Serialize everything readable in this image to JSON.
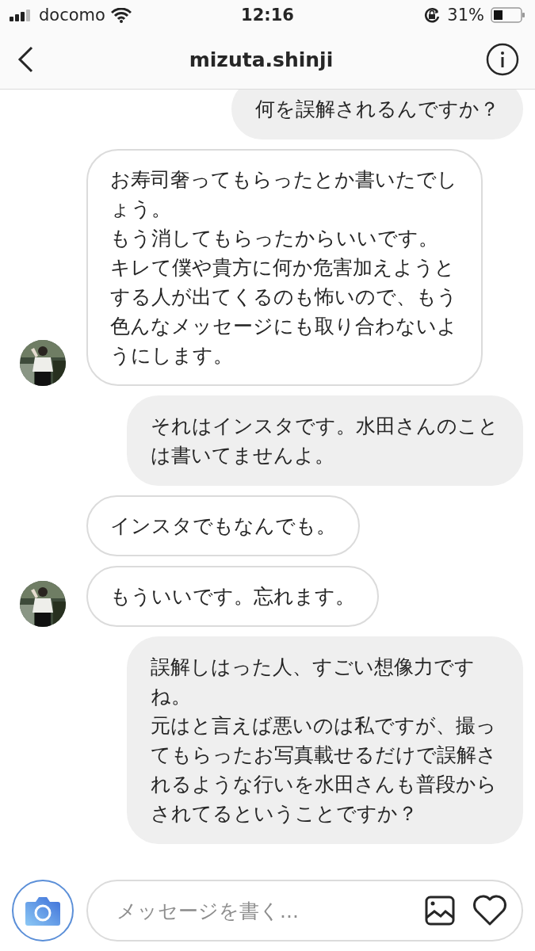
{
  "status_bar": {
    "carrier": "docomo",
    "time": "12:16",
    "battery": "31%"
  },
  "header": {
    "title": "mizuta.shinji"
  },
  "messages": [
    {
      "kind": "outgoing",
      "show_avatar": false,
      "paragraphs": [
        "何を誤解されるんですか？"
      ]
    },
    {
      "kind": "incoming",
      "show_avatar": true,
      "paragraphs": [
        "お寿司奢ってもらったとか書いたでしょう。",
        "もう消してもらったからいいです。",
        "キレて僕や貴方に何か危害加えようとする人が出てくるのも怖いので、もう色んなメッセージにも取り合わないようにします。"
      ]
    },
    {
      "kind": "outgoing",
      "show_avatar": false,
      "paragraphs": [
        "それはインスタです。水田さんのことは書いてませんよ。"
      ]
    },
    {
      "kind": "incoming",
      "show_avatar": false,
      "paragraphs": [
        "インスタでもなんでも。"
      ]
    },
    {
      "kind": "incoming",
      "show_avatar": true,
      "paragraphs": [
        "もういいです。忘れます。"
      ]
    },
    {
      "kind": "outgoing",
      "show_avatar": false,
      "paragraphs": [
        "誤解しはった人、すごい想像力ですね。",
        "元はと言えば悪いのは私ですが、撮ってもらったお写真載せるだけで誤解されるような行いを水田さんも普段からされてるということですか？"
      ]
    }
  ],
  "composer": {
    "placeholder": "メッセージを書く..."
  }
}
